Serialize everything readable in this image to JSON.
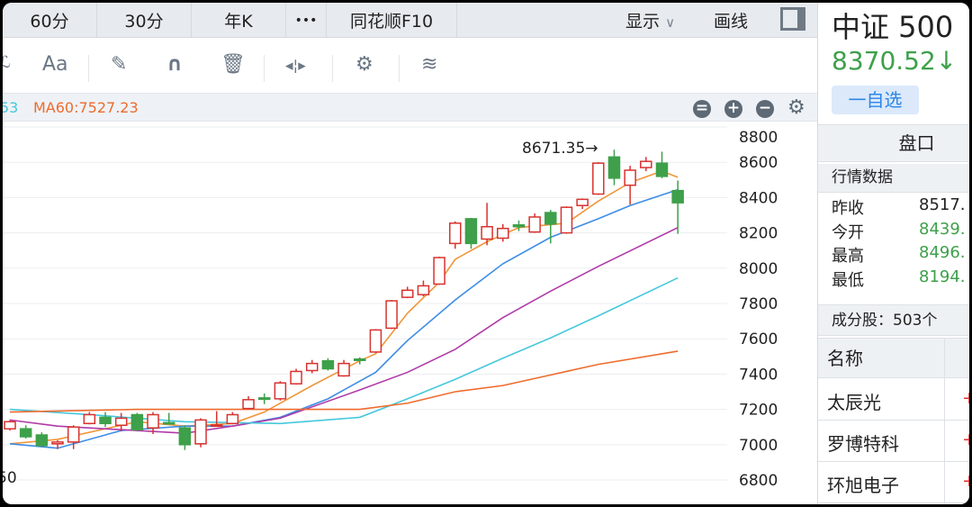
{
  "tabs": [
    {
      "label": "60分"
    },
    {
      "label": "30分"
    },
    {
      "label": "年K"
    },
    {
      "label": "•••"
    },
    {
      "label": "同花顺F10"
    }
  ],
  "tab_right": {
    "display": "显示",
    "display_caret": "∨",
    "draw": "画线"
  },
  "toolbar": {
    "partial": "ℒ",
    "font": "Aa"
  },
  "legend": {
    "ma30_partial": "53",
    "ma60": "MA60:7527.23"
  },
  "colors": {
    "up": "#d8322f",
    "down": "#3ea04a",
    "ma5": "#f0963a",
    "ma10": "#3d8de6",
    "ma20": "#b03aa8",
    "ma30": "#45c8dc",
    "ma60": "#ef6b2d",
    "accent": "#2d86e6"
  },
  "chart_data": {
    "type": "candlestick",
    "ylim": [
      6800,
      8800
    ],
    "yticks": [
      6800,
      7000,
      7200,
      7400,
      7600,
      7800,
      8000,
      8200,
      8400,
      8600,
      8800
    ],
    "ytick_labels": [
      "6800",
      "7000",
      "7200",
      "7400",
      "7600",
      "7800",
      "8000",
      "8200",
      "8400",
      "8600",
      "8800"
    ],
    "xlabel_partial": "50",
    "annotation": "8671.35→",
    "ohlc": [
      [
        7090,
        7140,
        7080,
        7130
      ],
      [
        7090,
        7110,
        7035,
        7045
      ],
      [
        7055,
        7070,
        6985,
        6995
      ],
      [
        7005,
        7025,
        6975,
        7015
      ],
      [
        7015,
        7110,
        6975,
        7100
      ],
      [
        7120,
        7185,
        7115,
        7170
      ],
      [
        7155,
        7185,
        7100,
        7120
      ],
      [
        7110,
        7180,
        7075,
        7150
      ],
      [
        7170,
        7180,
        7075,
        7085
      ],
      [
        7095,
        7185,
        7060,
        7170
      ],
      [
        7125,
        7180,
        7115,
        7120
      ],
      [
        7095,
        7110,
        6970,
        7000
      ],
      [
        7005,
        7150,
        6985,
        7140
      ],
      [
        7108,
        7190,
        7105,
        7112
      ],
      [
        7120,
        7185,
        7115,
        7170
      ],
      [
        7205,
        7275,
        7200,
        7255
      ],
      [
        7265,
        7290,
        7230,
        7260
      ],
      [
        7260,
        7360,
        7250,
        7350
      ],
      [
        7345,
        7430,
        7340,
        7415
      ],
      [
        7420,
        7480,
        7405,
        7460
      ],
      [
        7475,
        7490,
        7420,
        7430
      ],
      [
        7390,
        7480,
        7385,
        7460
      ],
      [
        7485,
        7495,
        7455,
        7478
      ],
      [
        7525,
        7655,
        7520,
        7650
      ],
      [
        7660,
        7820,
        7655,
        7815
      ],
      [
        7835,
        7895,
        7830,
        7875
      ],
      [
        7850,
        7930,
        7840,
        7900
      ],
      [
        7910,
        8065,
        7905,
        8060
      ],
      [
        8140,
        8265,
        8110,
        8255
      ],
      [
        8280,
        8285,
        8110,
        8140
      ],
      [
        8165,
        8370,
        8130,
        8235
      ],
      [
        8170,
        8250,
        8150,
        8225
      ],
      [
        8245,
        8270,
        8210,
        8235
      ],
      [
        8205,
        8310,
        8200,
        8290
      ],
      [
        8315,
        8330,
        8140,
        8250
      ],
      [
        8200,
        8350,
        8195,
        8345
      ],
      [
        8355,
        8395,
        8335,
        8390
      ],
      [
        8420,
        8600,
        8415,
        8595
      ],
      [
        8630,
        8671.35,
        8470,
        8510
      ],
      [
        8470,
        8580,
        8360,
        8555
      ],
      [
        8570,
        8630,
        8550,
        8605
      ],
      [
        8595,
        8660,
        8510,
        8520
      ],
      [
        8439.6,
        8496.3,
        8194.5,
        8370.52
      ]
    ],
    "ma": [
      {
        "name": "MA5",
        "points": [
          [
            0,
            7005
          ],
          [
            3,
            7030
          ],
          [
            8,
            7130
          ],
          [
            11,
            7105
          ],
          [
            14,
            7120
          ],
          [
            16,
            7185
          ],
          [
            19,
            7335
          ],
          [
            22,
            7475
          ],
          [
            23,
            7515
          ],
          [
            25,
            7745
          ],
          [
            27,
            7920
          ],
          [
            28,
            8050
          ],
          [
            30,
            8150
          ],
          [
            32,
            8230
          ],
          [
            35,
            8255
          ],
          [
            37,
            8380
          ],
          [
            39,
            8485
          ],
          [
            41,
            8550
          ],
          [
            42,
            8515
          ]
        ]
      },
      {
        "name": "MA10",
        "points": [
          [
            0,
            7005
          ],
          [
            3,
            6980
          ],
          [
            7,
            7080
          ],
          [
            11,
            7105
          ],
          [
            14,
            7105
          ],
          [
            17,
            7155
          ],
          [
            20,
            7260
          ],
          [
            23,
            7410
          ],
          [
            25,
            7590
          ],
          [
            28,
            7820
          ],
          [
            31,
            8025
          ],
          [
            34,
            8175
          ],
          [
            37,
            8280
          ],
          [
            39,
            8355
          ],
          [
            42,
            8445
          ]
        ]
      },
      {
        "name": "MA20",
        "points": [
          [
            0,
            7140
          ],
          [
            3,
            7105
          ],
          [
            11,
            7065
          ],
          [
            14,
            7105
          ],
          [
            17,
            7150
          ],
          [
            22,
            7310
          ],
          [
            25,
            7410
          ],
          [
            28,
            7540
          ],
          [
            31,
            7720
          ],
          [
            34,
            7870
          ],
          [
            37,
            8010
          ],
          [
            42,
            8230
          ]
        ]
      },
      {
        "name": "MA30",
        "points": [
          [
            0,
            7200
          ],
          [
            5,
            7170
          ],
          [
            11,
            7130
          ],
          [
            17,
            7120
          ],
          [
            22,
            7155
          ],
          [
            25,
            7260
          ],
          [
            28,
            7370
          ],
          [
            31,
            7490
          ],
          [
            34,
            7605
          ],
          [
            37,
            7730
          ],
          [
            42,
            7945
          ]
        ]
      },
      {
        "name": "MA60",
        "points": [
          [
            0,
            7185
          ],
          [
            8,
            7200
          ],
          [
            14,
            7200
          ],
          [
            22,
            7200
          ],
          [
            25,
            7235
          ],
          [
            28,
            7300
          ],
          [
            31,
            7335
          ],
          [
            34,
            7395
          ],
          [
            37,
            7455
          ],
          [
            42,
            7530
          ]
        ]
      }
    ]
  },
  "right": {
    "title": "中证 500",
    "price": "8370.52↓",
    "watchlist_button": "一自选",
    "section_title": "盘口",
    "quote_header": "行情数据",
    "quotes": [
      {
        "label": "昨收",
        "value": "8517."
      },
      {
        "label": "今开",
        "value": "8439."
      },
      {
        "label": "最高",
        "value": "8496."
      },
      {
        "label": "最低",
        "value": "8194."
      }
    ],
    "constituents": "成分股：503个",
    "name_header": "名称",
    "stocks": [
      {
        "name": "太辰光",
        "change": "+"
      },
      {
        "name": "罗博特科",
        "change": "+"
      },
      {
        "name": "环旭电子",
        "change": "+"
      }
    ]
  }
}
